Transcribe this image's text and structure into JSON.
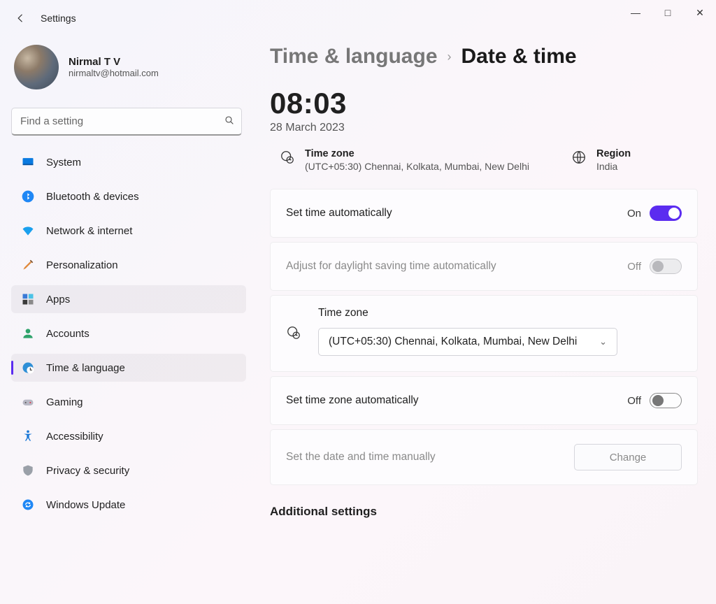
{
  "app_title": "Settings",
  "window": {
    "min": "—",
    "max": "□",
    "close": "✕"
  },
  "profile": {
    "name": "Nirmal T V",
    "email": "nirmaltv@hotmail.com"
  },
  "search": {
    "placeholder": "Find a setting"
  },
  "nav": {
    "items": [
      {
        "label": "System"
      },
      {
        "label": "Bluetooth & devices"
      },
      {
        "label": "Network & internet"
      },
      {
        "label": "Personalization"
      },
      {
        "label": "Apps"
      },
      {
        "label": "Accounts"
      },
      {
        "label": "Time & language"
      },
      {
        "label": "Gaming"
      },
      {
        "label": "Accessibility"
      },
      {
        "label": "Privacy & security"
      },
      {
        "label": "Windows Update"
      }
    ]
  },
  "breadcrumb": {
    "parent": "Time & language",
    "current": "Date & time"
  },
  "clock": {
    "time": "08:03",
    "date": "28 March 2023"
  },
  "summary": {
    "timezone_label": "Time zone",
    "timezone_value": "(UTC+05:30) Chennai, Kolkata, Mumbai, New Delhi",
    "region_label": "Region",
    "region_value": "India"
  },
  "settings": {
    "set_time_auto": {
      "label": "Set time automatically",
      "state": "On"
    },
    "dst_auto": {
      "label": "Adjust for daylight saving time automatically",
      "state": "Off"
    },
    "timezone": {
      "label": "Time zone",
      "value": "(UTC+05:30) Chennai, Kolkata, Mumbai, New Delhi"
    },
    "set_tz_auto": {
      "label": "Set time zone automatically",
      "state": "Off"
    },
    "manual": {
      "label": "Set the date and time manually",
      "button": "Change"
    }
  },
  "additional_header": "Additional settings"
}
